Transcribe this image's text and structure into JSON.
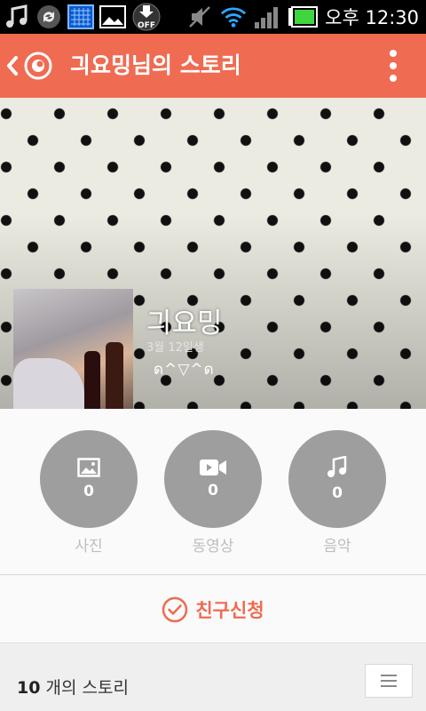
{
  "status_bar": {
    "icons": [
      "music-note-icon",
      "sync-icon",
      "keyboard-icon",
      "image-icon",
      "download-off-icon",
      "mute-icon",
      "wifi-icon",
      "signal-icon",
      "battery-icon"
    ],
    "off_label": "OFF",
    "time": "오후 12:30"
  },
  "header": {
    "title": "긔요밍님의 스토리",
    "color": "#ef6b52"
  },
  "profile": {
    "name": "긔요밍",
    "birthday": "3월 12일생",
    "status": "ด^▽^ด"
  },
  "counters": [
    {
      "icon": "photo-icon",
      "count": "0",
      "label": "사진"
    },
    {
      "icon": "video-camera-icon",
      "count": "0",
      "label": "동영상"
    },
    {
      "icon": "music-note-icon",
      "count": "0",
      "label": "음악"
    }
  ],
  "friend_request": {
    "label": "친구신청",
    "icon": "check-circle-icon"
  },
  "stories": {
    "count": "10",
    "suffix": " 개의 스토리"
  }
}
